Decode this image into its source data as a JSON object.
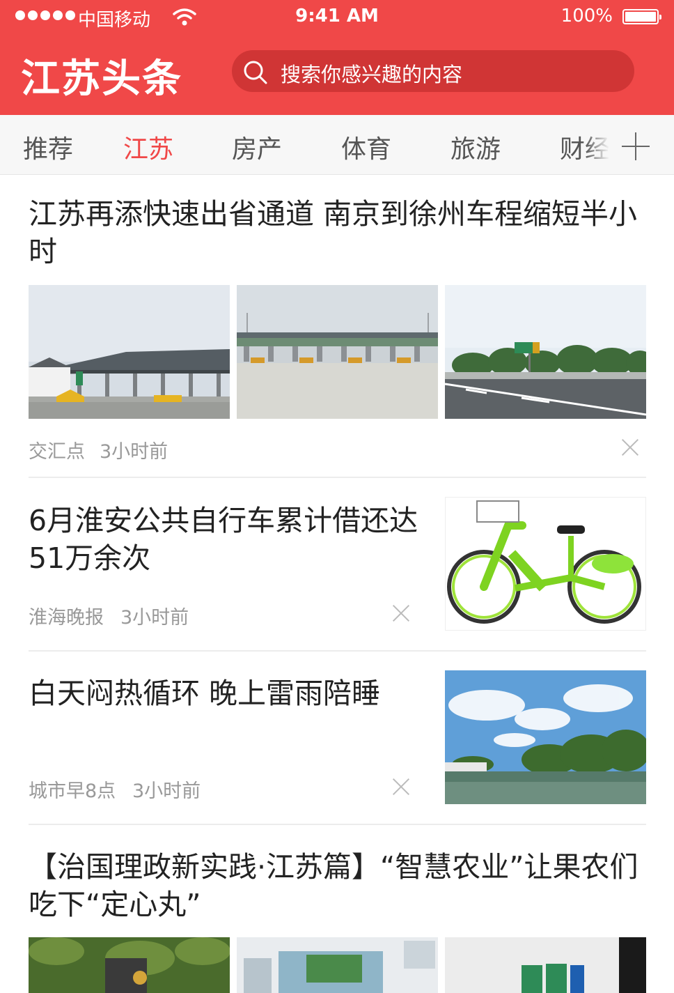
{
  "status_bar": {
    "carrier": "中国移动",
    "time": "9:41 AM",
    "battery": "100%"
  },
  "header": {
    "app_title": "江苏头条",
    "search_placeholder": "搜索你感兴趣的内容"
  },
  "tabs": [
    {
      "label": "推荐"
    },
    {
      "label": "江苏",
      "active": true
    },
    {
      "label": "房产"
    },
    {
      "label": "体育"
    },
    {
      "label": "旅游"
    },
    {
      "label": "财经"
    }
  ],
  "articles": [
    {
      "title": "江苏再添快速出省通道 南京到徐州车程缩短半小时",
      "source": "交汇点",
      "time": "3小时前",
      "layout": "three-images",
      "images": [
        "highway-toll-gate",
        "toll-station",
        "highway-road"
      ]
    },
    {
      "title": "6月淮安公共自行车累计借还达51万余次",
      "source": "淮海晚报",
      "time": "3小时前",
      "layout": "right-image",
      "images": [
        "green-bicycle"
      ]
    },
    {
      "title": "白天闷热循环 晚上雷雨陪睡",
      "source": "城市早8点",
      "time": "3小时前",
      "layout": "right-image",
      "images": [
        "lake-sky"
      ]
    },
    {
      "title": "【治国理政新实践·江苏篇】“智慧农业”让果农们吃下“定心丸”",
      "layout": "three-images",
      "images": [
        "fruit-orchard",
        "greenhouse-screen",
        "control-cabinet"
      ]
    }
  ],
  "colors": {
    "brand": "#f04848",
    "active_tab": "#f04848"
  }
}
